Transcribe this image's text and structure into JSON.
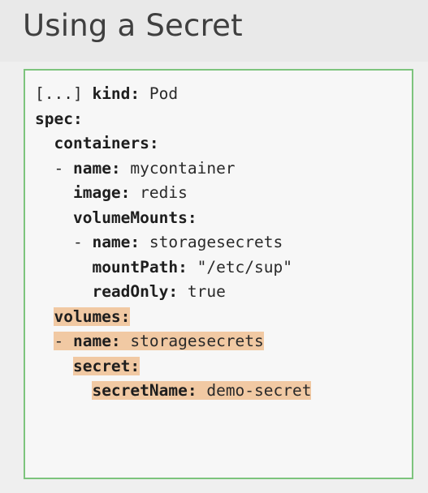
{
  "slide": {
    "title": "Using a Secret"
  },
  "code": {
    "lines": [
      {
        "indent": "",
        "prefix": "[...] ",
        "key": "kind:",
        "value": " Pod",
        "highlight": false
      },
      {
        "indent": "",
        "prefix": "",
        "key": "spec:",
        "value": "",
        "highlight": false
      },
      {
        "indent": "  ",
        "prefix": "",
        "key": "containers:",
        "value": "",
        "highlight": false
      },
      {
        "indent": "  ",
        "prefix": "- ",
        "key": "name:",
        "value": " mycontainer",
        "highlight": false
      },
      {
        "indent": "    ",
        "prefix": "",
        "key": "image:",
        "value": " redis",
        "highlight": false
      },
      {
        "indent": "    ",
        "prefix": "",
        "key": "volumeMounts:",
        "value": "",
        "highlight": false
      },
      {
        "indent": "    ",
        "prefix": "- ",
        "key": "name:",
        "value": " storagesecrets",
        "highlight": false
      },
      {
        "indent": "      ",
        "prefix": "",
        "key": "mountPath:",
        "value": " \"/etc/sup\"",
        "highlight": false
      },
      {
        "indent": "      ",
        "prefix": "",
        "key": "readOnly:",
        "value": " true",
        "highlight": false
      },
      {
        "indent": "  ",
        "prefix": "",
        "key": "volumes:",
        "value": "",
        "highlight": true
      },
      {
        "indent": "  ",
        "prefix": "- ",
        "key": "name:",
        "value": " storagesecrets",
        "highlight": true
      },
      {
        "indent": "    ",
        "prefix": "",
        "key": "secret:",
        "value": "",
        "highlight": true
      },
      {
        "indent": "      ",
        "prefix": "",
        "key": "secretName:",
        "value": " demo-secret",
        "highlight": true
      }
    ]
  },
  "colors": {
    "highlight": "#f1c9a3",
    "box_border": "#7dc47d"
  }
}
